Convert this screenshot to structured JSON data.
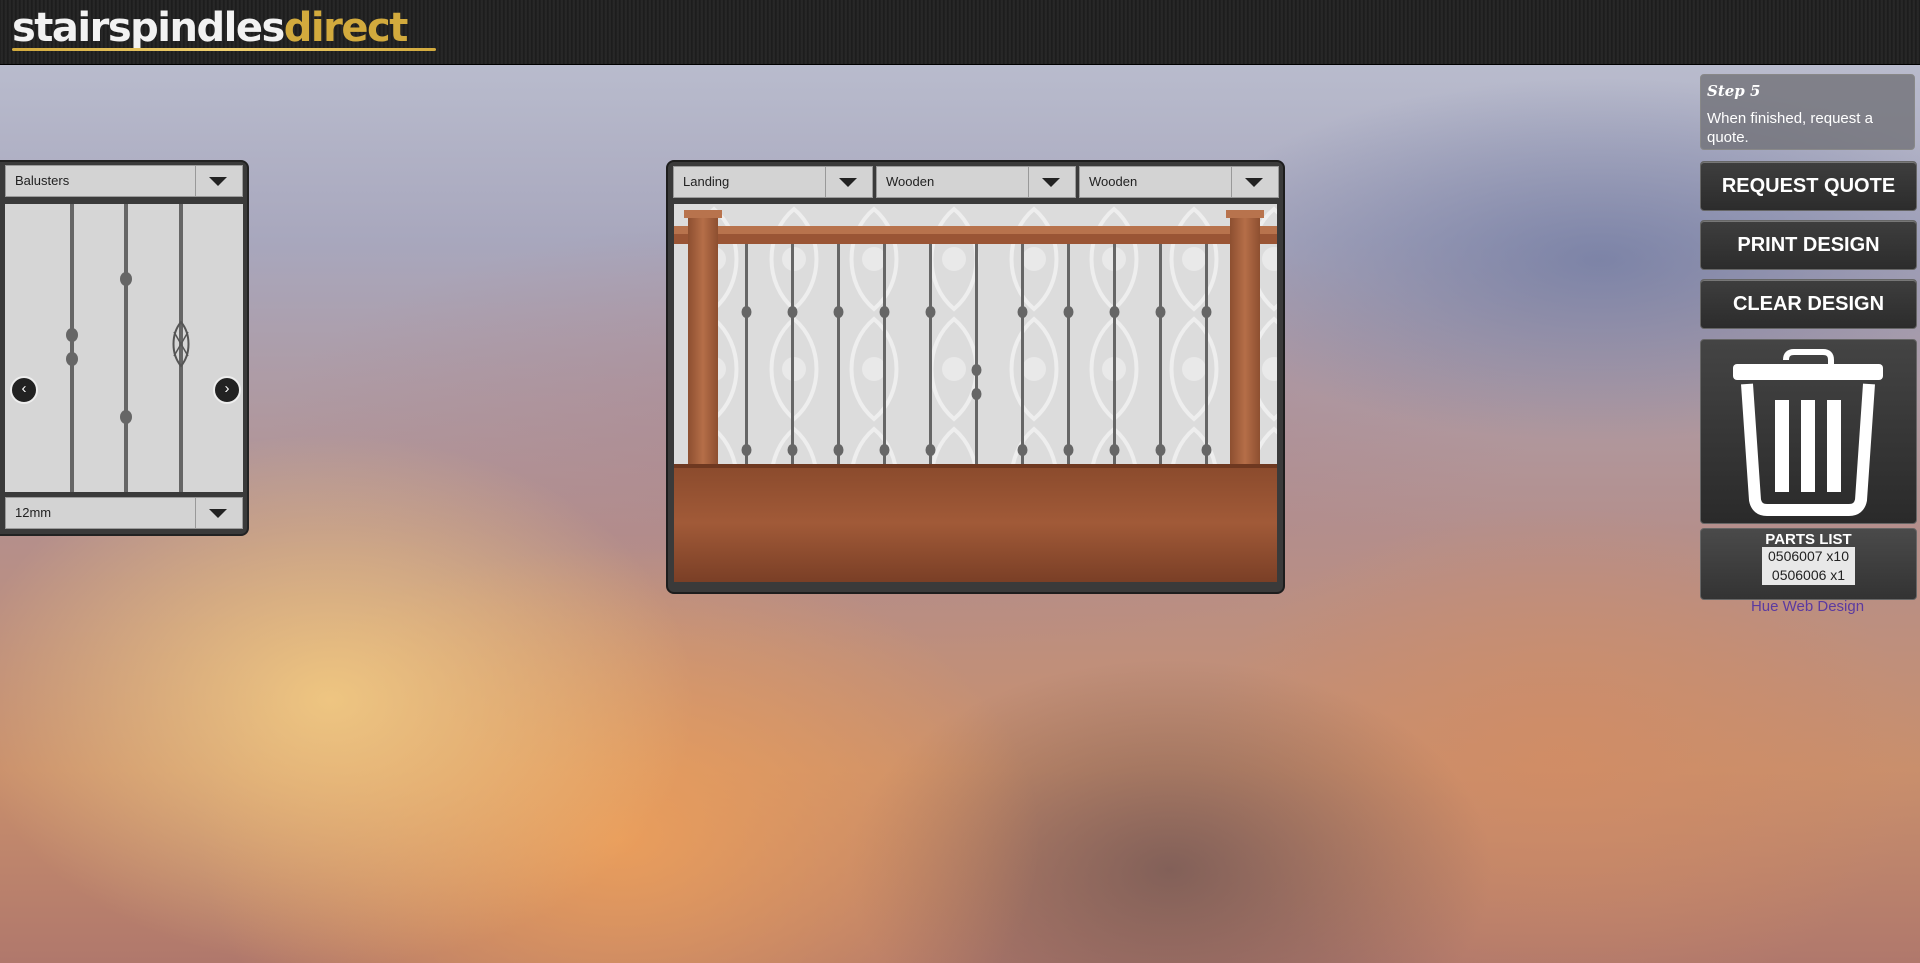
{
  "header": {
    "logo_part1": "stairspindles",
    "logo_part2": "direct"
  },
  "picker": {
    "category_select": "Balusters",
    "size_select": "12mm",
    "prev_icon": "chevron-left-icon",
    "next_icon": "chevron-right-icon"
  },
  "preview": {
    "selects": [
      "Landing",
      "Wooden",
      "Wooden"
    ]
  },
  "sidebar": {
    "step_title": "Step 5",
    "step_desc": "When finished, request a quote.",
    "buttons": [
      "REQUEST QUOTE",
      "PRINT DESIGN",
      "CLEAR DESIGN"
    ],
    "trash_icon": "trash-icon",
    "parts_title": "PARTS LIST",
    "parts": [
      "0506007 x10",
      "0506006 x1"
    ],
    "credit": "Hue Web Design"
  },
  "colors": {
    "accent_gold": "#d2aa3d",
    "wood": "#a4603f",
    "link": "#5b3aa0"
  }
}
